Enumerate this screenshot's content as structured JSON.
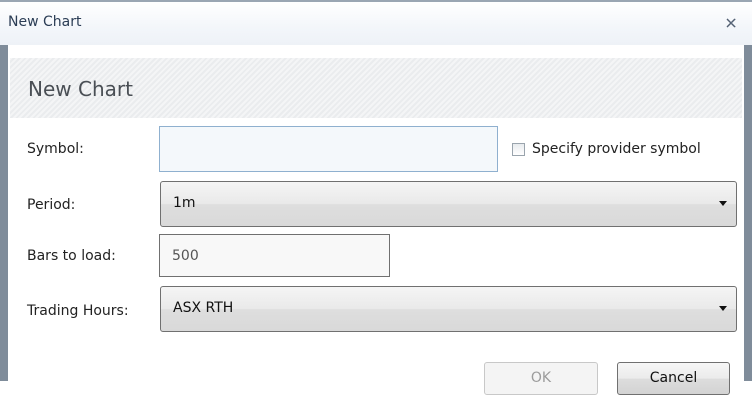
{
  "window": {
    "title": "New Chart",
    "close_icon": "close-icon"
  },
  "header": {
    "heading": "New Chart"
  },
  "form": {
    "symbol": {
      "label": "Symbol:",
      "value": ""
    },
    "provider_symbol": {
      "label": "Specify provider symbol",
      "checked": false
    },
    "period": {
      "label": "Period:",
      "value": "1m"
    },
    "bars_to_load": {
      "label": "Bars to load:",
      "value": "500"
    },
    "trading_hours": {
      "label": "Trading Hours:",
      "value": "ASX RTH"
    }
  },
  "buttons": {
    "ok_label": "OK",
    "ok_enabled": false,
    "cancel_label": "Cancel"
  }
}
